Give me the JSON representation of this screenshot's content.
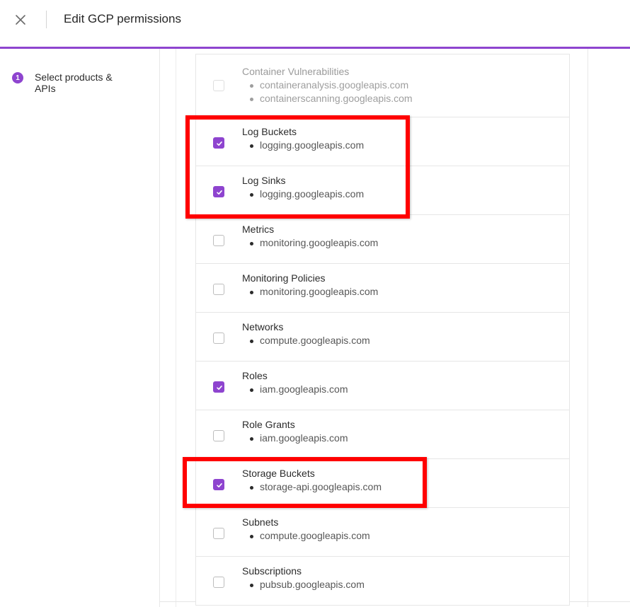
{
  "header": {
    "title": "Edit GCP permissions",
    "close_icon": "close-icon"
  },
  "sidebar": {
    "steps": [
      {
        "number": "1",
        "label": "Select products & APIs"
      }
    ]
  },
  "products": [
    {
      "name": "Container Vulnerabilities",
      "apis": [
        "containeranalysis.googleapis.com",
        "containerscanning.googleapis.com"
      ],
      "checked": false,
      "disabled": true
    },
    {
      "name": "Log Buckets",
      "apis": [
        "logging.googleapis.com"
      ],
      "checked": true,
      "disabled": false
    },
    {
      "name": "Log Sinks",
      "apis": [
        "logging.googleapis.com"
      ],
      "checked": true,
      "disabled": false
    },
    {
      "name": "Metrics",
      "apis": [
        "monitoring.googleapis.com"
      ],
      "checked": false,
      "disabled": false
    },
    {
      "name": "Monitoring Policies",
      "apis": [
        "monitoring.googleapis.com"
      ],
      "checked": false,
      "disabled": false
    },
    {
      "name": "Networks",
      "apis": [
        "compute.googleapis.com"
      ],
      "checked": false,
      "disabled": false
    },
    {
      "name": "Roles",
      "apis": [
        "iam.googleapis.com"
      ],
      "checked": true,
      "disabled": false
    },
    {
      "name": "Role Grants",
      "apis": [
        "iam.googleapis.com"
      ],
      "checked": false,
      "disabled": false
    },
    {
      "name": "Storage Buckets",
      "apis": [
        "storage-api.googleapis.com"
      ],
      "checked": true,
      "disabled": false
    },
    {
      "name": "Subnets",
      "apis": [
        "compute.googleapis.com"
      ],
      "checked": false,
      "disabled": false
    },
    {
      "name": "Subscriptions",
      "apis": [
        "pubsub.googleapis.com"
      ],
      "checked": false,
      "disabled": false
    }
  ],
  "colors": {
    "accent": "#8e44cf",
    "highlight": "#ff0000"
  }
}
